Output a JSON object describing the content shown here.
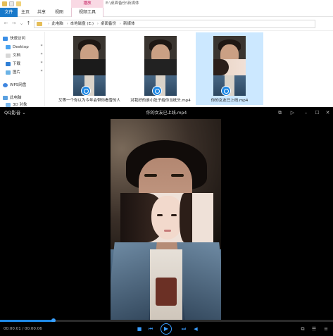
{
  "explorer": {
    "context_tab": "播放",
    "window_title": "E:\\桌面备份\\新媒体",
    "ribbon_tabs": {
      "file": "文件",
      "home": "主页",
      "share": "共享",
      "view": "视图",
      "play": "视频工具"
    },
    "address": [
      "此电脑",
      "本地磁盘 (E:)",
      "桌面备份",
      "新媒体"
    ],
    "sidebar": {
      "quick_access": "快速访问",
      "desktop": "Desktop",
      "documents": "文档",
      "downloads": "下载",
      "pictures": "图片",
      "wps": "WPS网盘",
      "this_pc": "此电脑",
      "objects3d": "3D 对象"
    },
    "files": [
      {
        "name": "又等一个你以为今年会带你看雪的人"
      },
      {
        "name": "对我好的谁小肚子给你当枕头.mp4"
      },
      {
        "name": "你的女友已上线.mp4"
      }
    ]
  },
  "player": {
    "logo": "QQ影音",
    "title": "你的女友已上线.mp4",
    "time": "00:00:01 / 00:00:06",
    "progress": 0.16,
    "accent_color": "#1e88e5"
  },
  "icons": {
    "back": "back-arrow-icon",
    "forward": "forward-arrow-icon",
    "up": "up-arrow-icon",
    "play": "play-icon",
    "stop": "stop-icon"
  }
}
